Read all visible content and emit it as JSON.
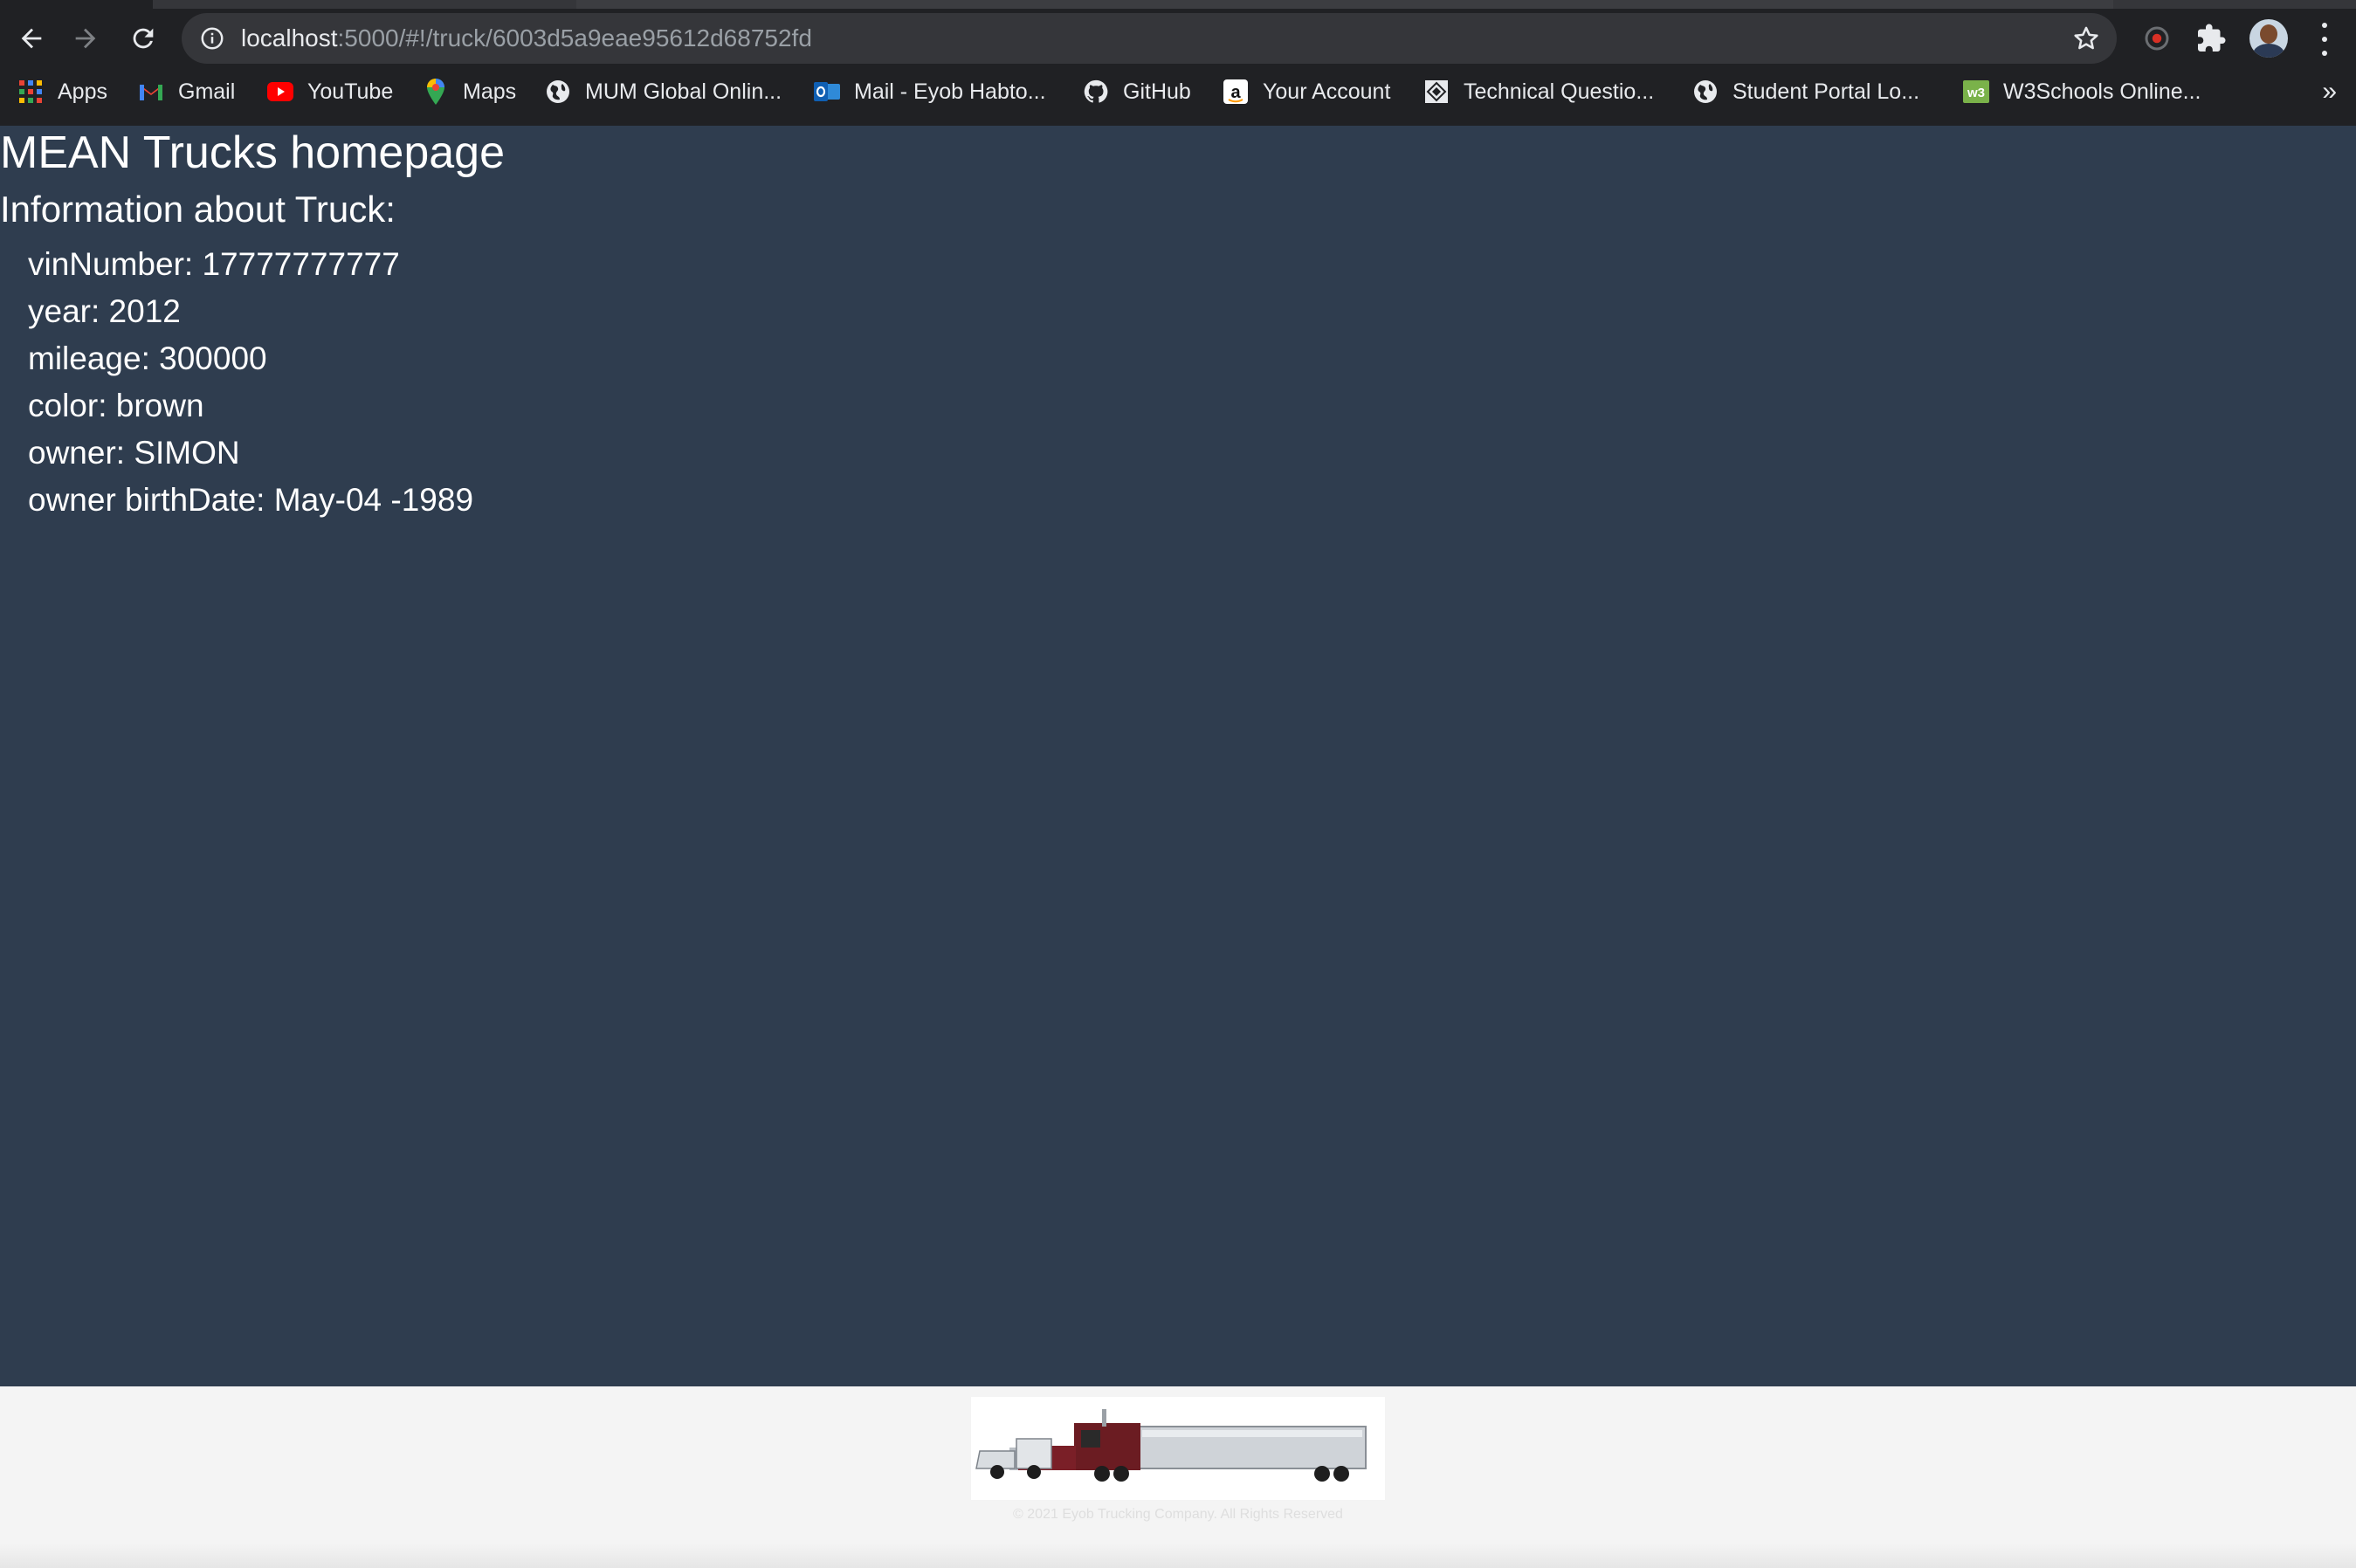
{
  "browser": {
    "url_host": "localhost",
    "url_rest": ":5000/#!/truck/6003d5a9eae95612d68752fd",
    "bookmarks": [
      {
        "label": "Apps",
        "icon": "apps-grid-icon"
      },
      {
        "label": "Gmail",
        "icon": "gmail-icon"
      },
      {
        "label": "YouTube",
        "icon": "youtube-icon"
      },
      {
        "label": "Maps",
        "icon": "maps-icon"
      },
      {
        "label": "MUM Global Onlin...",
        "icon": "globe-icon"
      },
      {
        "label": "Mail - Eyob Habto...",
        "icon": "outlook-icon"
      },
      {
        "label": "GitHub",
        "icon": "github-icon"
      },
      {
        "label": "Your Account",
        "icon": "amazon-icon"
      },
      {
        "label": "Technical Questio...",
        "icon": "technical-icon"
      },
      {
        "label": "Student Portal Lo...",
        "icon": "globe-icon"
      },
      {
        "label": "W3Schools Online...",
        "icon": "w3schools-icon"
      }
    ],
    "more_label": "»"
  },
  "page": {
    "title": "MEAN Trucks homepage",
    "subtitle": "Information about Truck:",
    "fields": [
      {
        "label": "vinNumber:",
        "value": "17777777777"
      },
      {
        "label": "year:",
        "value": "2012"
      },
      {
        "label": "mileage:",
        "value": "300000"
      },
      {
        "label": "color:",
        "value": "brown"
      },
      {
        "label": "owner:",
        "value": "SIMON"
      },
      {
        "label": "owner birthDate:",
        "value": "May-04 -1989"
      }
    ]
  },
  "footer": {
    "logo_icon": "truck-logo-icon",
    "copyright": "© 2021 Eyob Trucking Company. All Rights Reserved"
  },
  "colors": {
    "page_background": "#2f3d4f",
    "text": "#ffffff",
    "footer_background": "#f4f4f4",
    "chrome_background": "#202124"
  }
}
